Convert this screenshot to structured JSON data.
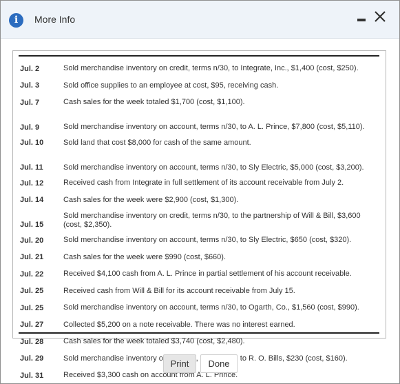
{
  "window": {
    "title": "More Info",
    "info_icon": "info-icon",
    "minimize_icon": "minimize-icon",
    "close_icon": "close-icon"
  },
  "transactions": [
    {
      "date": "Jul. 2",
      "text": "Sold merchandise inventory on credit, terms n/30, to Integrate, Inc., $1,400 (cost, $250)."
    },
    {
      "date": "Jul. 3",
      "text": "Sold office supplies to an employee at cost, $95, receiving cash."
    },
    {
      "date": "Jul. 7",
      "text": "Cash sales for the week totaled $1,700 (cost, $1,100)."
    },
    {
      "date": "Jul. 9",
      "text": "Sold merchandise inventory on account, terms n/30, to A. L. Prince, $7,800 (cost, $5,110)."
    },
    {
      "date": "Jul. 10",
      "text": "Sold land that cost $8,000 for cash of the same amount."
    },
    {
      "date": "Jul. 11",
      "text": "Sold merchandise inventory on account, terms n/30, to Sly Electric, $5,000 (cost, $3,200)."
    },
    {
      "date": "Jul. 12",
      "text": "Received cash from Integrate in full settlement of its account receivable from July 2."
    },
    {
      "date": "Jul. 14",
      "text": "Cash sales for the week were $2,900 (cost, $1,300)."
    },
    {
      "date": "Jul. 15",
      "text": "Sold merchandise inventory on credit, terms n/30, to the partnership of Will & Bill, $3,600 (cost, $2,350)."
    },
    {
      "date": "Jul. 20",
      "text": "Sold merchandise inventory on account, terms n/30, to Sly Electric, $650 (cost, $320)."
    },
    {
      "date": "Jul. 21",
      "text": "Cash sales for the week were $990 (cost, $660)."
    },
    {
      "date": "Jul. 22",
      "text": "Received $4,100 cash from A. L. Prince in partial settlement of his account receivable."
    },
    {
      "date": "Jul. 25",
      "text": "Received cash from Will & Bill for its account receivable from July 15."
    },
    {
      "date": "Jul. 25",
      "text": "Sold merchandise inventory on account, terms n/30, to Ogarth, Co., $1,560 (cost, $990)."
    },
    {
      "date": "Jul. 27",
      "text": "Collected $5,200 on a note receivable. There was no interest earned."
    },
    {
      "date": "Jul. 28",
      "text": "Cash sales for the week totaled $3,740 (cost, $2,480)."
    },
    {
      "date": "Jul. 29",
      "text": "Sold merchandise inventory on account, terms n/30, to R. O. Bills, $230 (cost, $160)."
    },
    {
      "date": "Jul. 31",
      "text": "Received $3,300 cash on account from A. L. Prince."
    }
  ],
  "buttons": {
    "print": "Print",
    "done": "Done"
  }
}
